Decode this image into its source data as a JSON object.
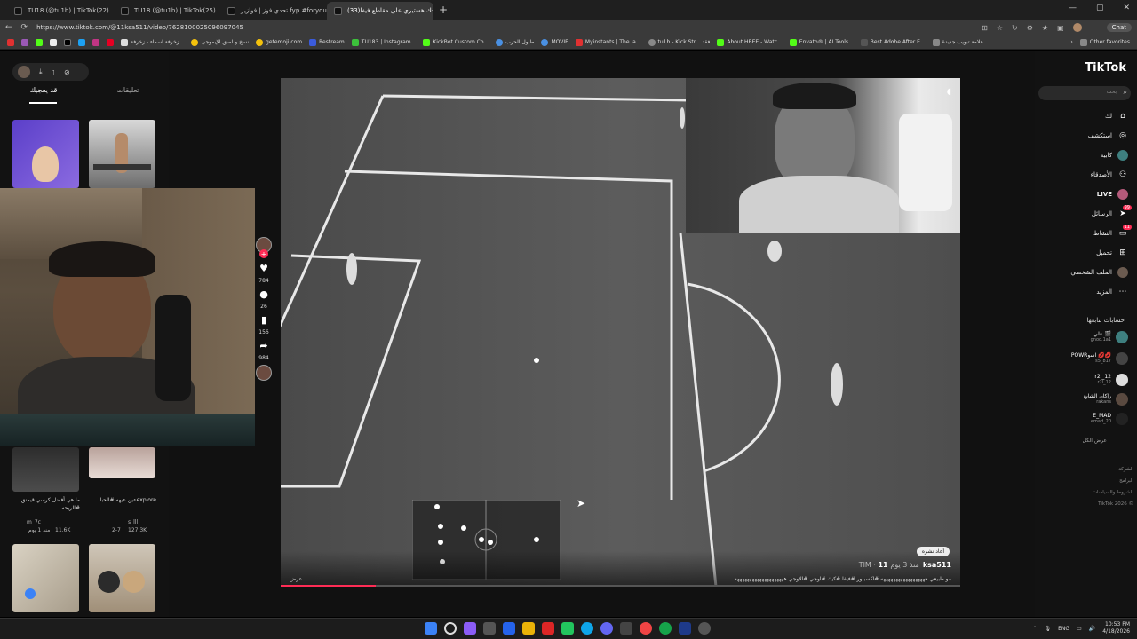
{
  "browser": {
    "tabs": [
      {
        "title": "TU18 (@tu1b) | TikTok(22)",
        "active": false
      },
      {
        "title": "TU18 (@tu1b) | TikTok(25)",
        "active": false
      },
      {
        "title": "تحدي فوز | فوازير fyp #foryou#(32) | Tok",
        "active": false
      },
      {
        "title": "ضحك هستيري على مقاطع فيفا(33)",
        "active": true
      }
    ],
    "new_tab": "+",
    "url": "https://www.tiktok.com/@11ksa511/video/7628100025096097045",
    "chat_label": "Chat",
    "window_controls": [
      "—",
      "▢",
      "✕"
    ]
  },
  "bookmarks": [
    {
      "label": "زخرفة اسماء - زخرفة...",
      "color": "#ddd"
    },
    {
      "label": "نسخ و لصق الإيموجي",
      "color": "#f4c20d"
    },
    {
      "label": "getemoji.com",
      "color": "#f4c20d"
    },
    {
      "label": "Restream",
      "color": "#3b5bdb"
    },
    {
      "label": "TU183 | Instagram...",
      "color": "#3cc13b"
    },
    {
      "label": "KickBot Custom Co...",
      "color": "#53fc18"
    },
    {
      "label": "طبول الحرب",
      "color": "#4a90e2"
    },
    {
      "label": "MOVIE",
      "color": "#4a90e2"
    },
    {
      "label": "Myinstants | The la...",
      "color": "#e03131"
    },
    {
      "label": "tu1b - Kick Str... فقد",
      "color": "#888"
    },
    {
      "label": "About HBEE - Watc...",
      "color": "#53fc18"
    },
    {
      "label": "Envato® | AI Tools...",
      "color": "#53fc18"
    },
    {
      "label": "Best Adobe After E...",
      "color": "#555"
    },
    {
      "label": "علامة تبويب جديدة",
      "color": "#888"
    },
    {
      "label": "Other favorites",
      "color": "#888"
    }
  ],
  "left_panel": {
    "tabs": [
      {
        "label": "تعليقات",
        "active": false
      },
      {
        "label": "قد يعجبك",
        "active": true
      }
    ],
    "thumbnails": [
      {
        "caption": "ما هي أفضل كرسي قيمنق #الريحه",
        "author": "m_7c",
        "views": "11.6K",
        "time": "منذ 1 يوم"
      },
      {
        "caption": "عين عيهه #الحبلـexplore",
        "author": "s_lll",
        "views": "127.3K",
        "time": "2-7"
      }
    ],
    "actions": [
      {
        "icon": "heart-icon",
        "count": "784"
      },
      {
        "icon": "comment-icon",
        "count": "26"
      },
      {
        "icon": "bookmark-icon",
        "count": "156"
      },
      {
        "icon": "share-icon",
        "count": "984"
      }
    ]
  },
  "video": {
    "author": "11ksa511",
    "author_meta": "TIM · منذ 3 يوم",
    "repost_label": "أعاد نشره",
    "description": "مو طبيعي ههههههههههههههههههه #اكسبلور #فيفا #كيك #اوجي #الاوجي ههههههههههههههههههههه",
    "more_label": "عرض",
    "progress": 0.14
  },
  "right_nav": {
    "logo": "TikTok",
    "search_placeholder": "بحث",
    "items": [
      {
        "label": "لك",
        "icon": "home-icon"
      },
      {
        "label": "استكشف",
        "icon": "compass-icon"
      },
      {
        "label": "كابيه",
        "icon": "avatar-icon"
      },
      {
        "label": "الأصدقاء",
        "icon": "friends-icon"
      },
      {
        "label": "LIVE",
        "icon": "live-icon"
      },
      {
        "label": "الرسائل",
        "icon": "message-icon",
        "badge": "99"
      },
      {
        "label": "النشاط",
        "icon": "activity-icon",
        "badge": "11"
      },
      {
        "label": "تحميل",
        "icon": "upload-icon"
      },
      {
        "label": "الملف الشخصي",
        "icon": "profile-icon"
      },
      {
        "label": "المزيد",
        "icon": "more-icon"
      }
    ],
    "following_title": "حسابات تتابعها",
    "following": [
      {
        "name": "علي 🎬",
        "handle": "gnoo.1a1"
      },
      {
        "name": "POWRاسو 💋💋",
        "handle": "s5_817"
      },
      {
        "name": "r2l_12",
        "handle": "r2l_12"
      },
      {
        "name": "راكان الشايع",
        "handle": "rakans"
      },
      {
        "name": "E_MAD",
        "handle": "emad_20"
      }
    ],
    "see_all": "عرض الكل",
    "footer": [
      "الشركة",
      "البرامج",
      "الشروط والسياسات",
      "TikTok 2026 ©"
    ]
  },
  "taskbar": {
    "lang": "ENG",
    "time": "10:53 PM",
    "date": "4/18/2026"
  }
}
